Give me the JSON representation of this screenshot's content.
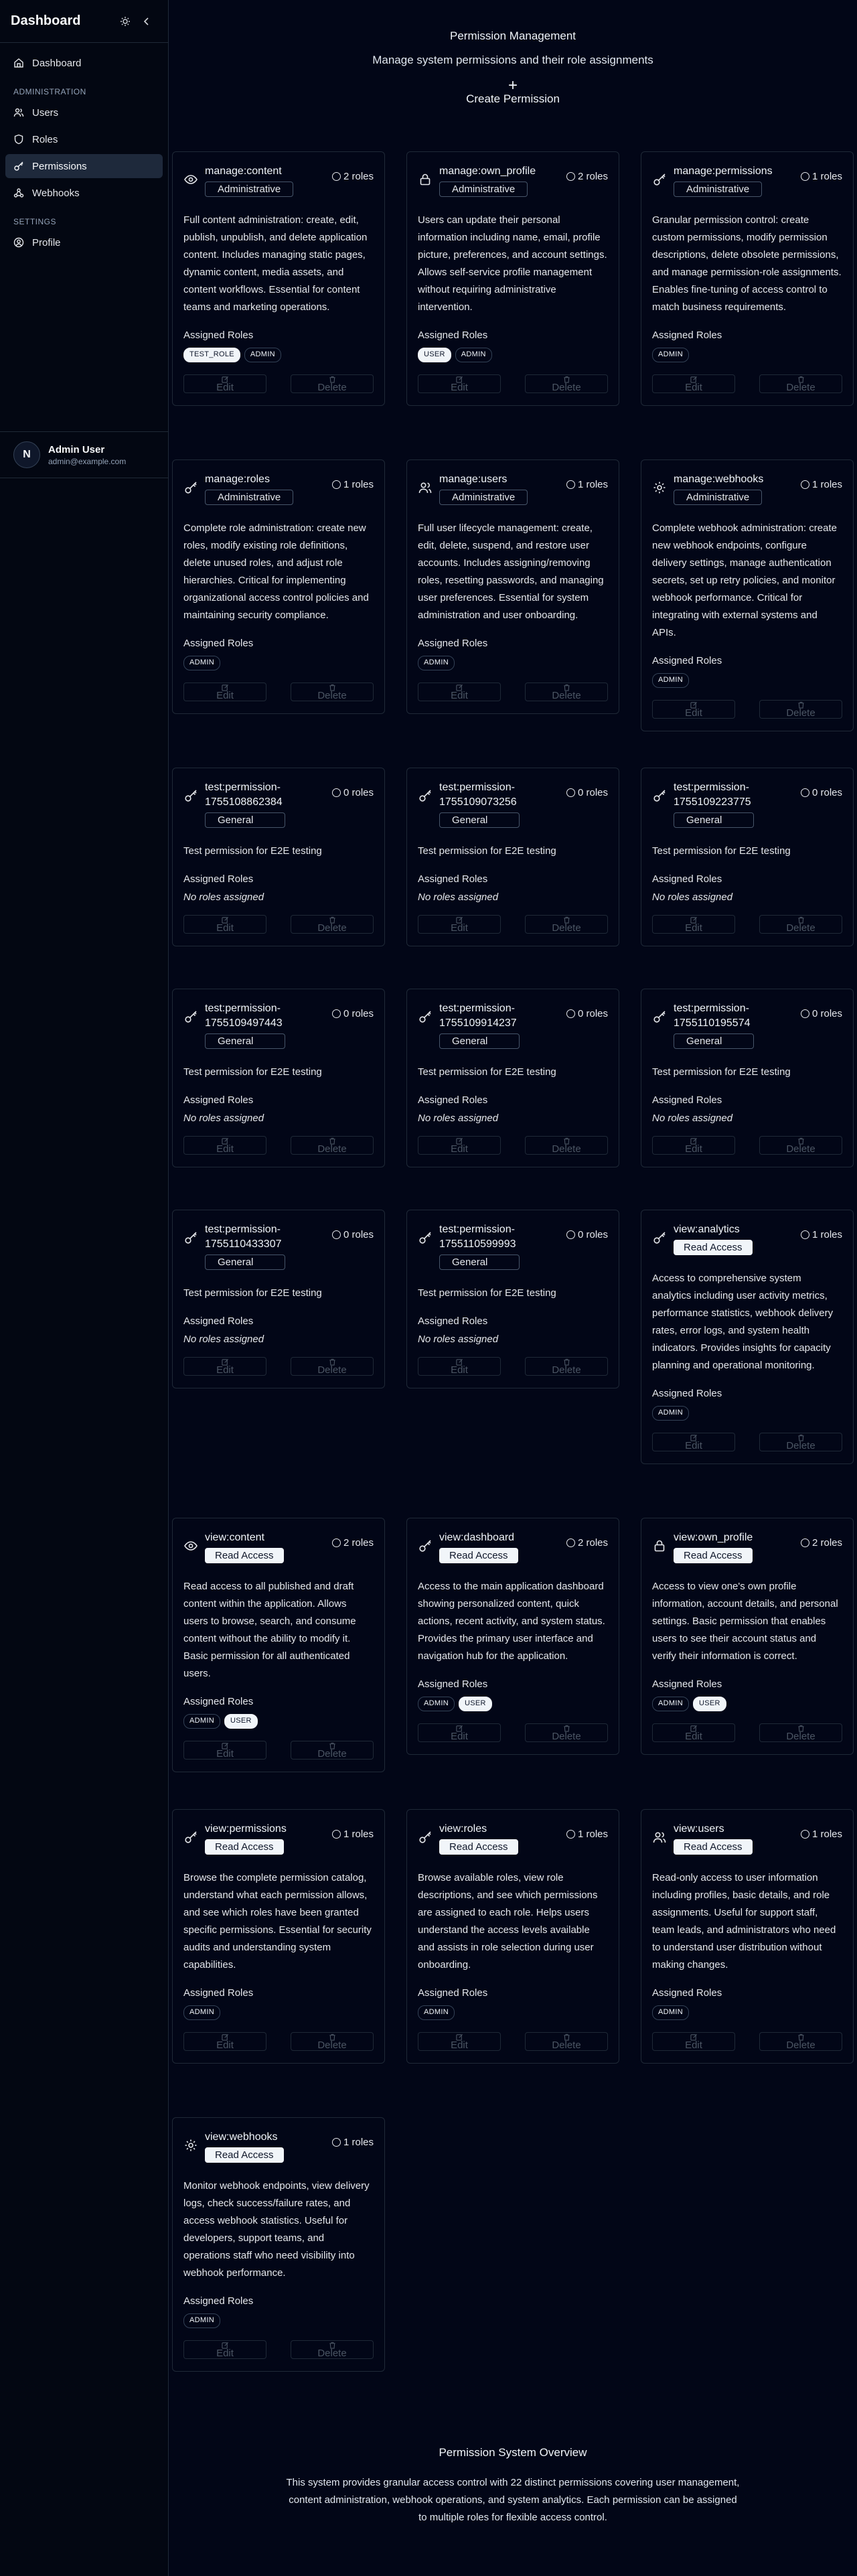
{
  "sidebar": {
    "title": "Dashboard",
    "items": {
      "dashboard": "Dashboard",
      "users": "Users",
      "roles": "Roles",
      "permissions": "Permissions",
      "webhooks": "Webhooks",
      "profile": "Profile"
    },
    "sections": {
      "administration": "ADMINISTRATION",
      "settings": "SETTINGS"
    },
    "user": {
      "initial": "N",
      "name": "Admin User",
      "email": "admin@example.com"
    }
  },
  "header": {
    "title": "Permission Management",
    "subtitle": "Manage system permissions and their role assignments",
    "create_label": "Create Permission"
  },
  "labels": {
    "assigned_roles": "Assigned Roles",
    "no_roles": "No roles assigned",
    "edit": "Edit",
    "delete": "Delete"
  },
  "permissions": [
    {
      "name": "manage:content",
      "category": "Administrative",
      "roles_count": "2 roles",
      "icon": "eye-icon",
      "description": "Full content administration: create, edit, publish, unpublish, and delete application content. Includes managing static pages, dynamic content, media assets, and content workflows. Essential for content teams and marketing operations.",
      "roles": [
        "TEST_ROLE",
        "ADMIN"
      ]
    },
    {
      "name": "manage:own_profile",
      "category": "Administrative",
      "roles_count": "2 roles",
      "icon": "lock-icon",
      "description": "Users can update their personal information including name, email, profile picture, preferences, and account settings. Allows self-service profile management without requiring administrative intervention.",
      "roles": [
        "USER",
        "ADMIN"
      ]
    },
    {
      "name": "manage:permissions",
      "category": "Administrative",
      "roles_count": "1 roles",
      "icon": "key-icon",
      "description": "Granular permission control: create custom permissions, modify permission descriptions, delete obsolete permissions, and manage permission-role assignments. Enables fine-tuning of access control to match business requirements.",
      "roles": [
        "ADMIN"
      ]
    },
    {
      "name": "manage:roles",
      "category": "Administrative",
      "roles_count": "1 roles",
      "icon": "key-icon",
      "description": "Complete role administration: create new roles, modify existing role definitions, delete unused roles, and adjust role hierarchies. Critical for implementing organizational access control policies and maintaining security compliance.",
      "roles": [
        "ADMIN"
      ]
    },
    {
      "name": "manage:users",
      "category": "Administrative",
      "roles_count": "1 roles",
      "icon": "users-icon",
      "description": "Full user lifecycle management: create, edit, delete, suspend, and restore user accounts. Includes assigning/removing roles, resetting passwords, and managing user preferences. Essential for system administration and user onboarding.",
      "roles": [
        "ADMIN"
      ]
    },
    {
      "name": "manage:webhooks",
      "category": "Administrative",
      "roles_count": "1 roles",
      "icon": "gear-icon",
      "description": "Complete webhook administration: create new webhook endpoints, configure delivery settings, manage authentication secrets, set up retry policies, and monitor webhook performance. Critical for integrating with external systems and APIs.",
      "roles": [
        "ADMIN"
      ]
    },
    {
      "name": "test:permission-1755108862384",
      "category": "General",
      "roles_count": "0 roles",
      "icon": "key-icon",
      "description": "Test permission for E2E testing",
      "roles": []
    },
    {
      "name": "test:permission-1755109073256",
      "category": "General",
      "roles_count": "0 roles",
      "icon": "key-icon",
      "description": "Test permission for E2E testing",
      "roles": []
    },
    {
      "name": "test:permission-1755109223775",
      "category": "General",
      "roles_count": "0 roles",
      "icon": "key-icon",
      "description": "Test permission for E2E testing",
      "roles": []
    },
    {
      "name": "test:permission-1755109497443",
      "category": "General",
      "roles_count": "0 roles",
      "icon": "key-icon",
      "description": "Test permission for E2E testing",
      "roles": []
    },
    {
      "name": "test:permission-1755109914237",
      "category": "General",
      "roles_count": "0 roles",
      "icon": "key-icon",
      "description": "Test permission for E2E testing",
      "roles": []
    },
    {
      "name": "test:permission-1755110195574",
      "category": "General",
      "roles_count": "0 roles",
      "icon": "key-icon",
      "description": "Test permission for E2E testing",
      "roles": []
    },
    {
      "name": "test:permission-1755110433307",
      "category": "General",
      "roles_count": "0 roles",
      "icon": "key-icon",
      "description": "Test permission for E2E testing",
      "roles": []
    },
    {
      "name": "test:permission-1755110599993",
      "category": "General",
      "roles_count": "0 roles",
      "icon": "key-icon",
      "description": "Test permission for E2E testing",
      "roles": []
    },
    {
      "name": "view:analytics",
      "category": "Read Access",
      "roles_count": "1 roles",
      "icon": "key-icon",
      "description": "Access to comprehensive system analytics including user activity metrics, performance statistics, webhook delivery rates, error logs, and system health indicators. Provides insights for capacity planning and operational monitoring.",
      "roles": [
        "ADMIN"
      ]
    },
    {
      "name": "view:content",
      "category": "Read Access",
      "roles_count": "2 roles",
      "icon": "eye-icon",
      "description": "Read access to all published and draft content within the application. Allows users to browse, search, and consume content without the ability to modify it. Basic permission for all authenticated users.",
      "roles": [
        "ADMIN",
        "USER"
      ]
    },
    {
      "name": "view:dashboard",
      "category": "Read Access",
      "roles_count": "2 roles",
      "icon": "key-icon",
      "description": "Access to the main application dashboard showing personalized content, quick actions, recent activity, and system status. Provides the primary user interface and navigation hub for the application.",
      "roles": [
        "ADMIN",
        "USER"
      ]
    },
    {
      "name": "view:own_profile",
      "category": "Read Access",
      "roles_count": "2 roles",
      "icon": "lock-icon",
      "description": "Access to view one's own profile information, account details, and personal settings. Basic permission that enables users to see their account status and verify their information is correct.",
      "roles": [
        "ADMIN",
        "USER"
      ]
    },
    {
      "name": "view:permissions",
      "category": "Read Access",
      "roles_count": "1 roles",
      "icon": "key-icon",
      "description": "Browse the complete permission catalog, understand what each permission allows, and see which roles have been granted specific permissions. Essential for security audits and understanding system capabilities.",
      "roles": [
        "ADMIN"
      ]
    },
    {
      "name": "view:roles",
      "category": "Read Access",
      "roles_count": "1 roles",
      "icon": "key-icon",
      "description": "Browse available roles, view role descriptions, and see which permissions are assigned to each role. Helps users understand the access levels available and assists in role selection during user onboarding.",
      "roles": [
        "ADMIN"
      ]
    },
    {
      "name": "view:users",
      "category": "Read Access",
      "roles_count": "1 roles",
      "icon": "users-icon",
      "description": "Read-only access to user information including profiles, basic details, and role assignments. Useful for support staff, team leads, and administrators who need to understand user distribution without making changes.",
      "roles": [
        "ADMIN"
      ]
    },
    {
      "name": "view:webhooks",
      "category": "Read Access",
      "roles_count": "1 roles",
      "icon": "gear-icon",
      "description": "Monitor webhook endpoints, view delivery logs, check success/failure rates, and access webhook statistics. Useful for developers, support teams, and operations staff who need visibility into webhook performance.",
      "roles": [
        "ADMIN"
      ]
    }
  ],
  "overview": {
    "title": "Permission System Overview",
    "text": "This system provides granular access control with 22 distinct permissions covering user management, content administration, webhook operations, and system analytics. Each permission can be assigned to multiple roles for flexible access control."
  }
}
